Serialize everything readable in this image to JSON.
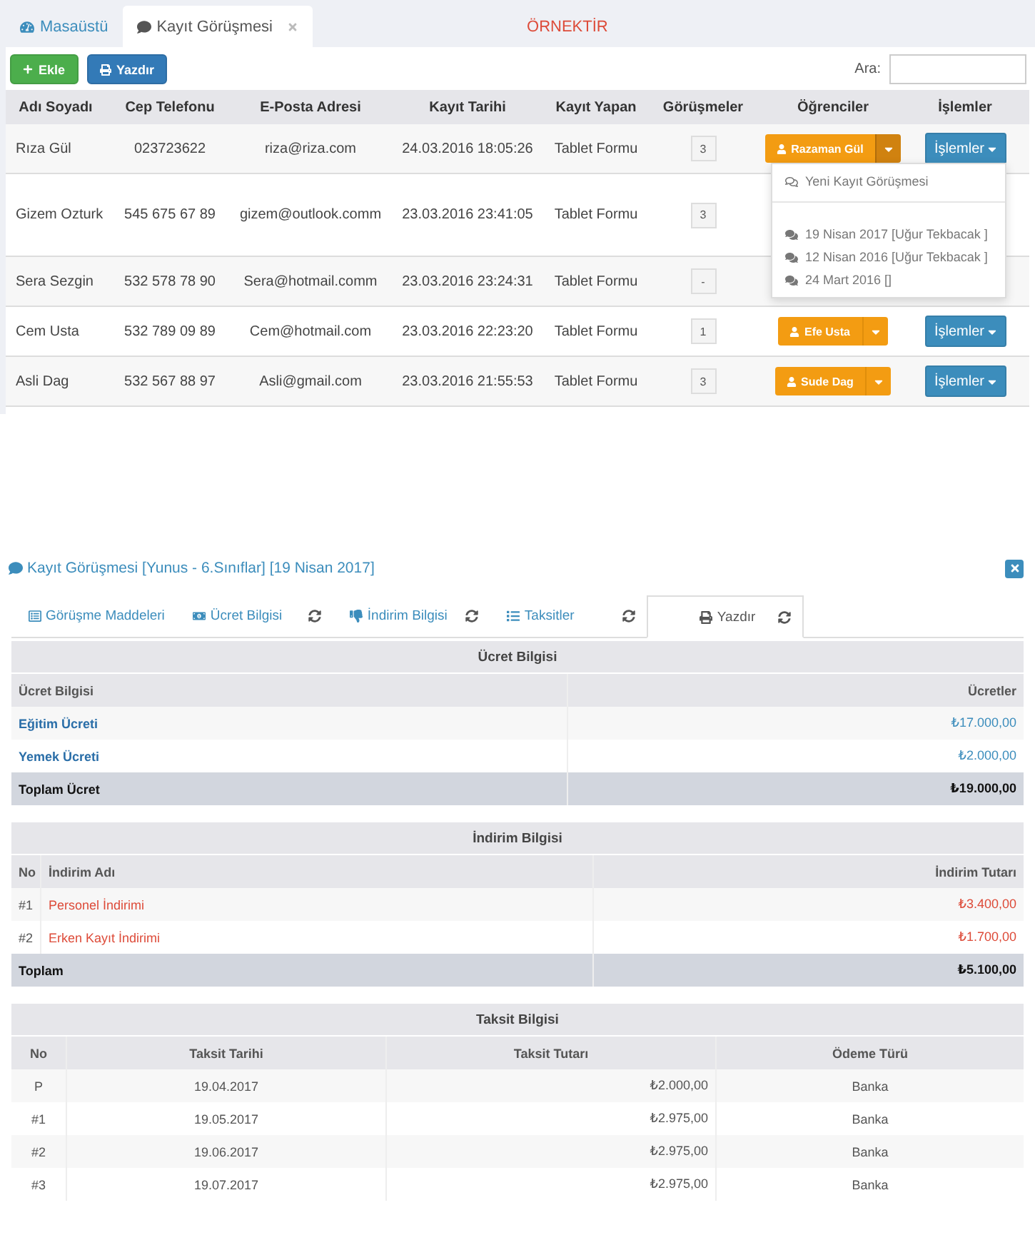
{
  "tabs": [
    {
      "label": "Masaüstü",
      "selected": false,
      "closable": false
    },
    {
      "label": "Kayıt Görüşmesi",
      "selected": true,
      "closable": true
    }
  ],
  "notice": "ÖRNEKTİR",
  "toolbar": {
    "buttons": [
      {
        "label": "Ekle",
        "kind": "add"
      },
      {
        "label": "Yazdır",
        "kind": "print"
      }
    ],
    "search_label": "Ara:"
  },
  "table": {
    "columns": [
      "Adı Soyadı",
      "Cep Telefonu",
      "E-Posta Adresi",
      "Kayıt Tarihi",
      "Kayıt Yapan",
      "Görüşmeler",
      "Öğrenciler",
      "İşlemler"
    ],
    "rows": [
      {
        "name": "Rıza Gül",
        "phone": "023723622",
        "email": "riza@riza.com",
        "date": "24.03.2016 18:05:26",
        "by": "Tablet Formu",
        "count": "3",
        "student": "Razaman Gül",
        "menu_open": true,
        "actions": "İşlemler"
      },
      {
        "name": "Gizem Ozturk",
        "phone": "545 675 67 89",
        "email": "gizem@outlook.comm",
        "date": "23.03.2016 23:41:05",
        "by": "Tablet Formu",
        "count": "3"
      },
      {
        "name": "Sera Sezgin",
        "phone": "532 578 78 90",
        "email": "Sera@hotmail.comm",
        "date": "23.03.2016 23:24:31",
        "by": "Tablet Formu",
        "count": "-"
      },
      {
        "name": "Cem Usta",
        "phone": "532 789 09 89",
        "email": "Cem@hotmail.com",
        "date": "23.03.2016 22:23:20",
        "by": "Tablet Formu",
        "count": "1",
        "student": "Efe Usta",
        "menu_open": false,
        "actions": "İşlemler"
      },
      {
        "name": "Asli Dag",
        "phone": "532 567 88 97",
        "email": "Asli@gmail.com",
        "date": "23.03.2016 21:55:53",
        "by": "Tablet Formu",
        "count": "3",
        "student": "Sude Dag",
        "menu_open": false,
        "actions": "İşlemler"
      }
    ]
  },
  "dropdown": {
    "items": [
      {
        "label": "Yeni Kayıt Görüşmesi",
        "kind": "new"
      },
      {
        "label": "19 Nisan 2017 [Uğur Tekbacak ]",
        "kind": "record"
      },
      {
        "label": "12 Nisan 2016 [Uğur Tekbacak ]",
        "kind": "record"
      },
      {
        "label": "24 Mart 2016 []",
        "kind": "record"
      }
    ]
  },
  "dialog": {
    "title": "Kayıt Görüşmesi [Yunus - 6.Sınıflar] [19 Nisan 2017]",
    "tabs": [
      {
        "label": "Görüşme Maddeleri",
        "kind": "form",
        "refresh": false,
        "selected": false
      },
      {
        "label": "Ücret Bilgisi",
        "kind": "money",
        "refresh": true,
        "selected": false
      },
      {
        "label": "İndirim Bilgisi",
        "kind": "discount",
        "refresh": true,
        "selected": false
      },
      {
        "label": "Taksitler",
        "kind": "list",
        "refresh": true,
        "selected": false
      },
      {
        "label": "Yazdır",
        "kind": "print",
        "refresh": true,
        "selected": true
      }
    ],
    "fees": {
      "title": "Ücret Bilgisi",
      "columns": [
        "Ücret Bilgisi",
        "Ücretler"
      ],
      "rows": [
        {
          "name": "Eğitim Ücreti",
          "amount": "₺17.000,00"
        },
        {
          "name": "Yemek Ücreti",
          "amount": "₺2.000,00"
        }
      ],
      "total": {
        "label": "Toplam Ücret",
        "amount": "₺19.000,00"
      }
    },
    "discounts": {
      "title": "İndirim Bilgisi",
      "columns": [
        "No",
        "İndirim Adı",
        "İndirim Tutarı"
      ],
      "rows": [
        {
          "no": "#1",
          "name": "Personel İndirimi",
          "amount": "₺3.400,00"
        },
        {
          "no": "#2",
          "name": "Erken Kayıt İndirimi",
          "amount": "₺1.700,00"
        }
      ],
      "total": {
        "label": "Toplam",
        "amount": "₺5.100,00"
      }
    },
    "installments": {
      "title": "Taksit Bilgisi",
      "columns": [
        "No",
        "Taksit Tarihi",
        "Taksit Tutarı",
        "Ödeme Türü"
      ],
      "rows": [
        {
          "no": "P",
          "date": "19.04.2017",
          "amount": "₺2.000,00",
          "method": "Banka"
        },
        {
          "no": "#1",
          "date": "19.05.2017",
          "amount": "₺2.975,00",
          "method": "Banka"
        },
        {
          "no": "#2",
          "date": "19.06.2017",
          "amount": "₺2.975,00",
          "method": "Banka"
        },
        {
          "no": "#3",
          "date": "19.07.2017",
          "amount": "₺2.975,00",
          "method": "Banka"
        }
      ]
    }
  }
}
